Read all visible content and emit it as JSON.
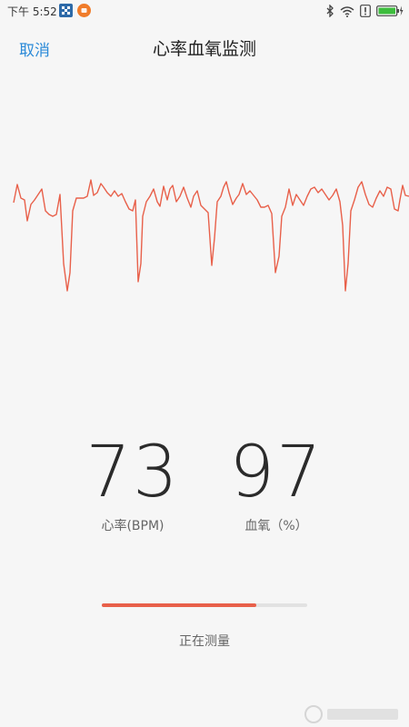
{
  "status_bar": {
    "time": "下午 5:52",
    "icons": [
      "notification-grid-icon",
      "notification-app-icon",
      "bluetooth-icon",
      "wifi-icon",
      "alert-icon",
      "battery-icon"
    ]
  },
  "nav": {
    "cancel_label": "取消",
    "title": "心率血氧监测"
  },
  "metrics": {
    "heart_rate": {
      "value": "73",
      "label": "心率(BPM)"
    },
    "spo2": {
      "value": "97",
      "label": "血氧（%）"
    }
  },
  "progress": {
    "fraction": 0.75,
    "label": "正在测量",
    "fill_color": "#e8604a"
  },
  "colors": {
    "accent": "#2b8ad8",
    "wave": "#e8604a"
  }
}
